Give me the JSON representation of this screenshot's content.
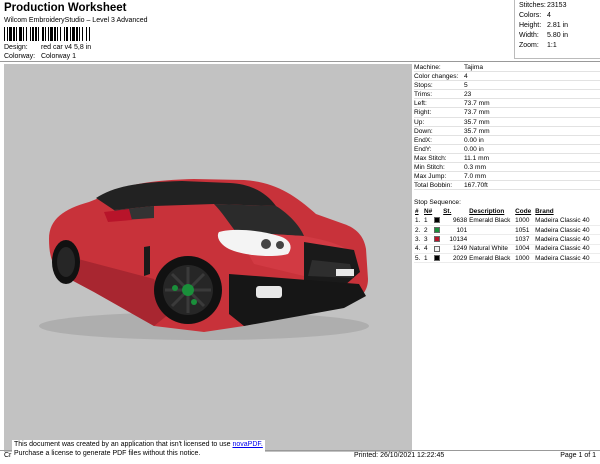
{
  "header": {
    "title": "Production Worksheet",
    "subtitle": "Wilcom EmbroideryStudio – Level 3 Advanced",
    "design_label": "Design:",
    "design_value": "red car v4 5,8 in",
    "colorway_label": "Colorway:",
    "colorway_value": "Colorway 1"
  },
  "stats": {
    "stitches_label": "Stitches:",
    "stitches": "23153",
    "colors_label": "Colors:",
    "colors": "4",
    "height_label": "Height:",
    "height": "2.81 in",
    "width_label": "Width:",
    "width": "5.80 in",
    "zoom_label": "Zoom:",
    "zoom": "1:1"
  },
  "info": [
    {
      "k": "Machine:",
      "v": "Tajima"
    },
    {
      "k": "Color changes:",
      "v": "4"
    },
    {
      "k": "Stops:",
      "v": "5"
    },
    {
      "k": "Trims:",
      "v": "23"
    },
    {
      "k": "Left:",
      "v": "73.7 mm"
    },
    {
      "k": "Right:",
      "v": "73.7 mm"
    },
    {
      "k": "Up:",
      "v": "35.7 mm"
    },
    {
      "k": "Down:",
      "v": "35.7 mm"
    },
    {
      "k": "EndX:",
      "v": "0.00 in"
    },
    {
      "k": "EndY:",
      "v": "0.00 in"
    },
    {
      "k": "Max Stitch:",
      "v": "11.1 mm"
    },
    {
      "k": "Min Stitch:",
      "v": "0.3 mm"
    },
    {
      "k": "Max Jump:",
      "v": "7.0 mm"
    },
    {
      "k": "Total Bobbin:",
      "v": "167.70ft"
    }
  ],
  "stop_sequence": {
    "title": "Stop Sequence:",
    "headers": [
      "#",
      "N#",
      "",
      "St.",
      "Description",
      "Code",
      "Brand"
    ],
    "rows": [
      {
        "num": "1.",
        "n": "1",
        "color": "#000000",
        "st": "9638",
        "desc": "Emerald Black",
        "code": "1000",
        "brand": "Madeira Classic 40"
      },
      {
        "num": "2.",
        "n": "2",
        "color": "#1a8f3a",
        "st": "101",
        "desc": "",
        "code": "1051",
        "brand": "Madeira Classic 40"
      },
      {
        "num": "3.",
        "n": "3",
        "color": "#b8142a",
        "st": "10134",
        "desc": "",
        "code": "1037",
        "brand": "Madeira Classic 40"
      },
      {
        "num": "4.",
        "n": "4",
        "color": "#f4f4f4",
        "st": "1249",
        "desc": "Natural White",
        "code": "1004",
        "brand": "Madeira Classic 40"
      },
      {
        "num": "5.",
        "n": "1",
        "color": "#000000",
        "st": "2029",
        "desc": "Emerald Black",
        "code": "1000",
        "brand": "Madeira Classic 40"
      }
    ]
  },
  "footer": {
    "notice_line1": "This document was created by an application that isn't licensed to use",
    "notice_link": "novaPDF.",
    "notice_line2": "Purchase a license to generate PDF files without this notice.",
    "cr": "Cr",
    "printed": "Printed: 26/10/2021 12:22:45",
    "page": "Page 1 of 1"
  },
  "colors": {
    "design_bg": "#c2c2c2",
    "car_body": "#c8323a",
    "car_dark": "#8e1f26",
    "black": "#111111",
    "green": "#1a8f3a",
    "white": "#f4f4f4"
  }
}
